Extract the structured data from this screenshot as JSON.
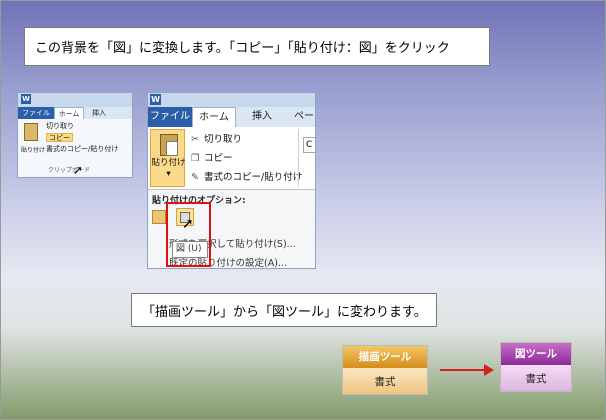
{
  "instruction_top": "この背景を「図」に変換します。「コピー」「貼り付け：図」をクリック",
  "instruction_bottom": "「描画ツール」から「図ツール」に変わります。",
  "small_ribbon": {
    "app_icon": "W",
    "tabs": [
      "ファイル",
      "ホーム",
      "挿入"
    ],
    "paste_label": "貼り付け",
    "items": [
      "切り取り",
      "コピー",
      "書式のコピー/貼り付け"
    ],
    "group_label": "クリップボード"
  },
  "large_ribbon": {
    "app_icon": "W",
    "tabs": [
      "ファイル",
      "ホーム",
      "挿入",
      "ペー"
    ],
    "paste_label": "貼り付け",
    "items": [
      "切り取り",
      "コピー",
      "書式のコピー/貼り付け"
    ],
    "right_box": "C",
    "options_header": "貼り付けのオプション:",
    "menu_items": [
      "形式を選択して貼り付け(S)...",
      "既定の貼り付けの設定(A)..."
    ],
    "tooltip": "図 (U)"
  },
  "tool_from": {
    "header": "描画ツール",
    "sub": "書式"
  },
  "tool_to": {
    "header": "図ツール",
    "sub": "書式"
  },
  "colors": {
    "highlight": "#e01010",
    "arrow": "#d42020"
  }
}
